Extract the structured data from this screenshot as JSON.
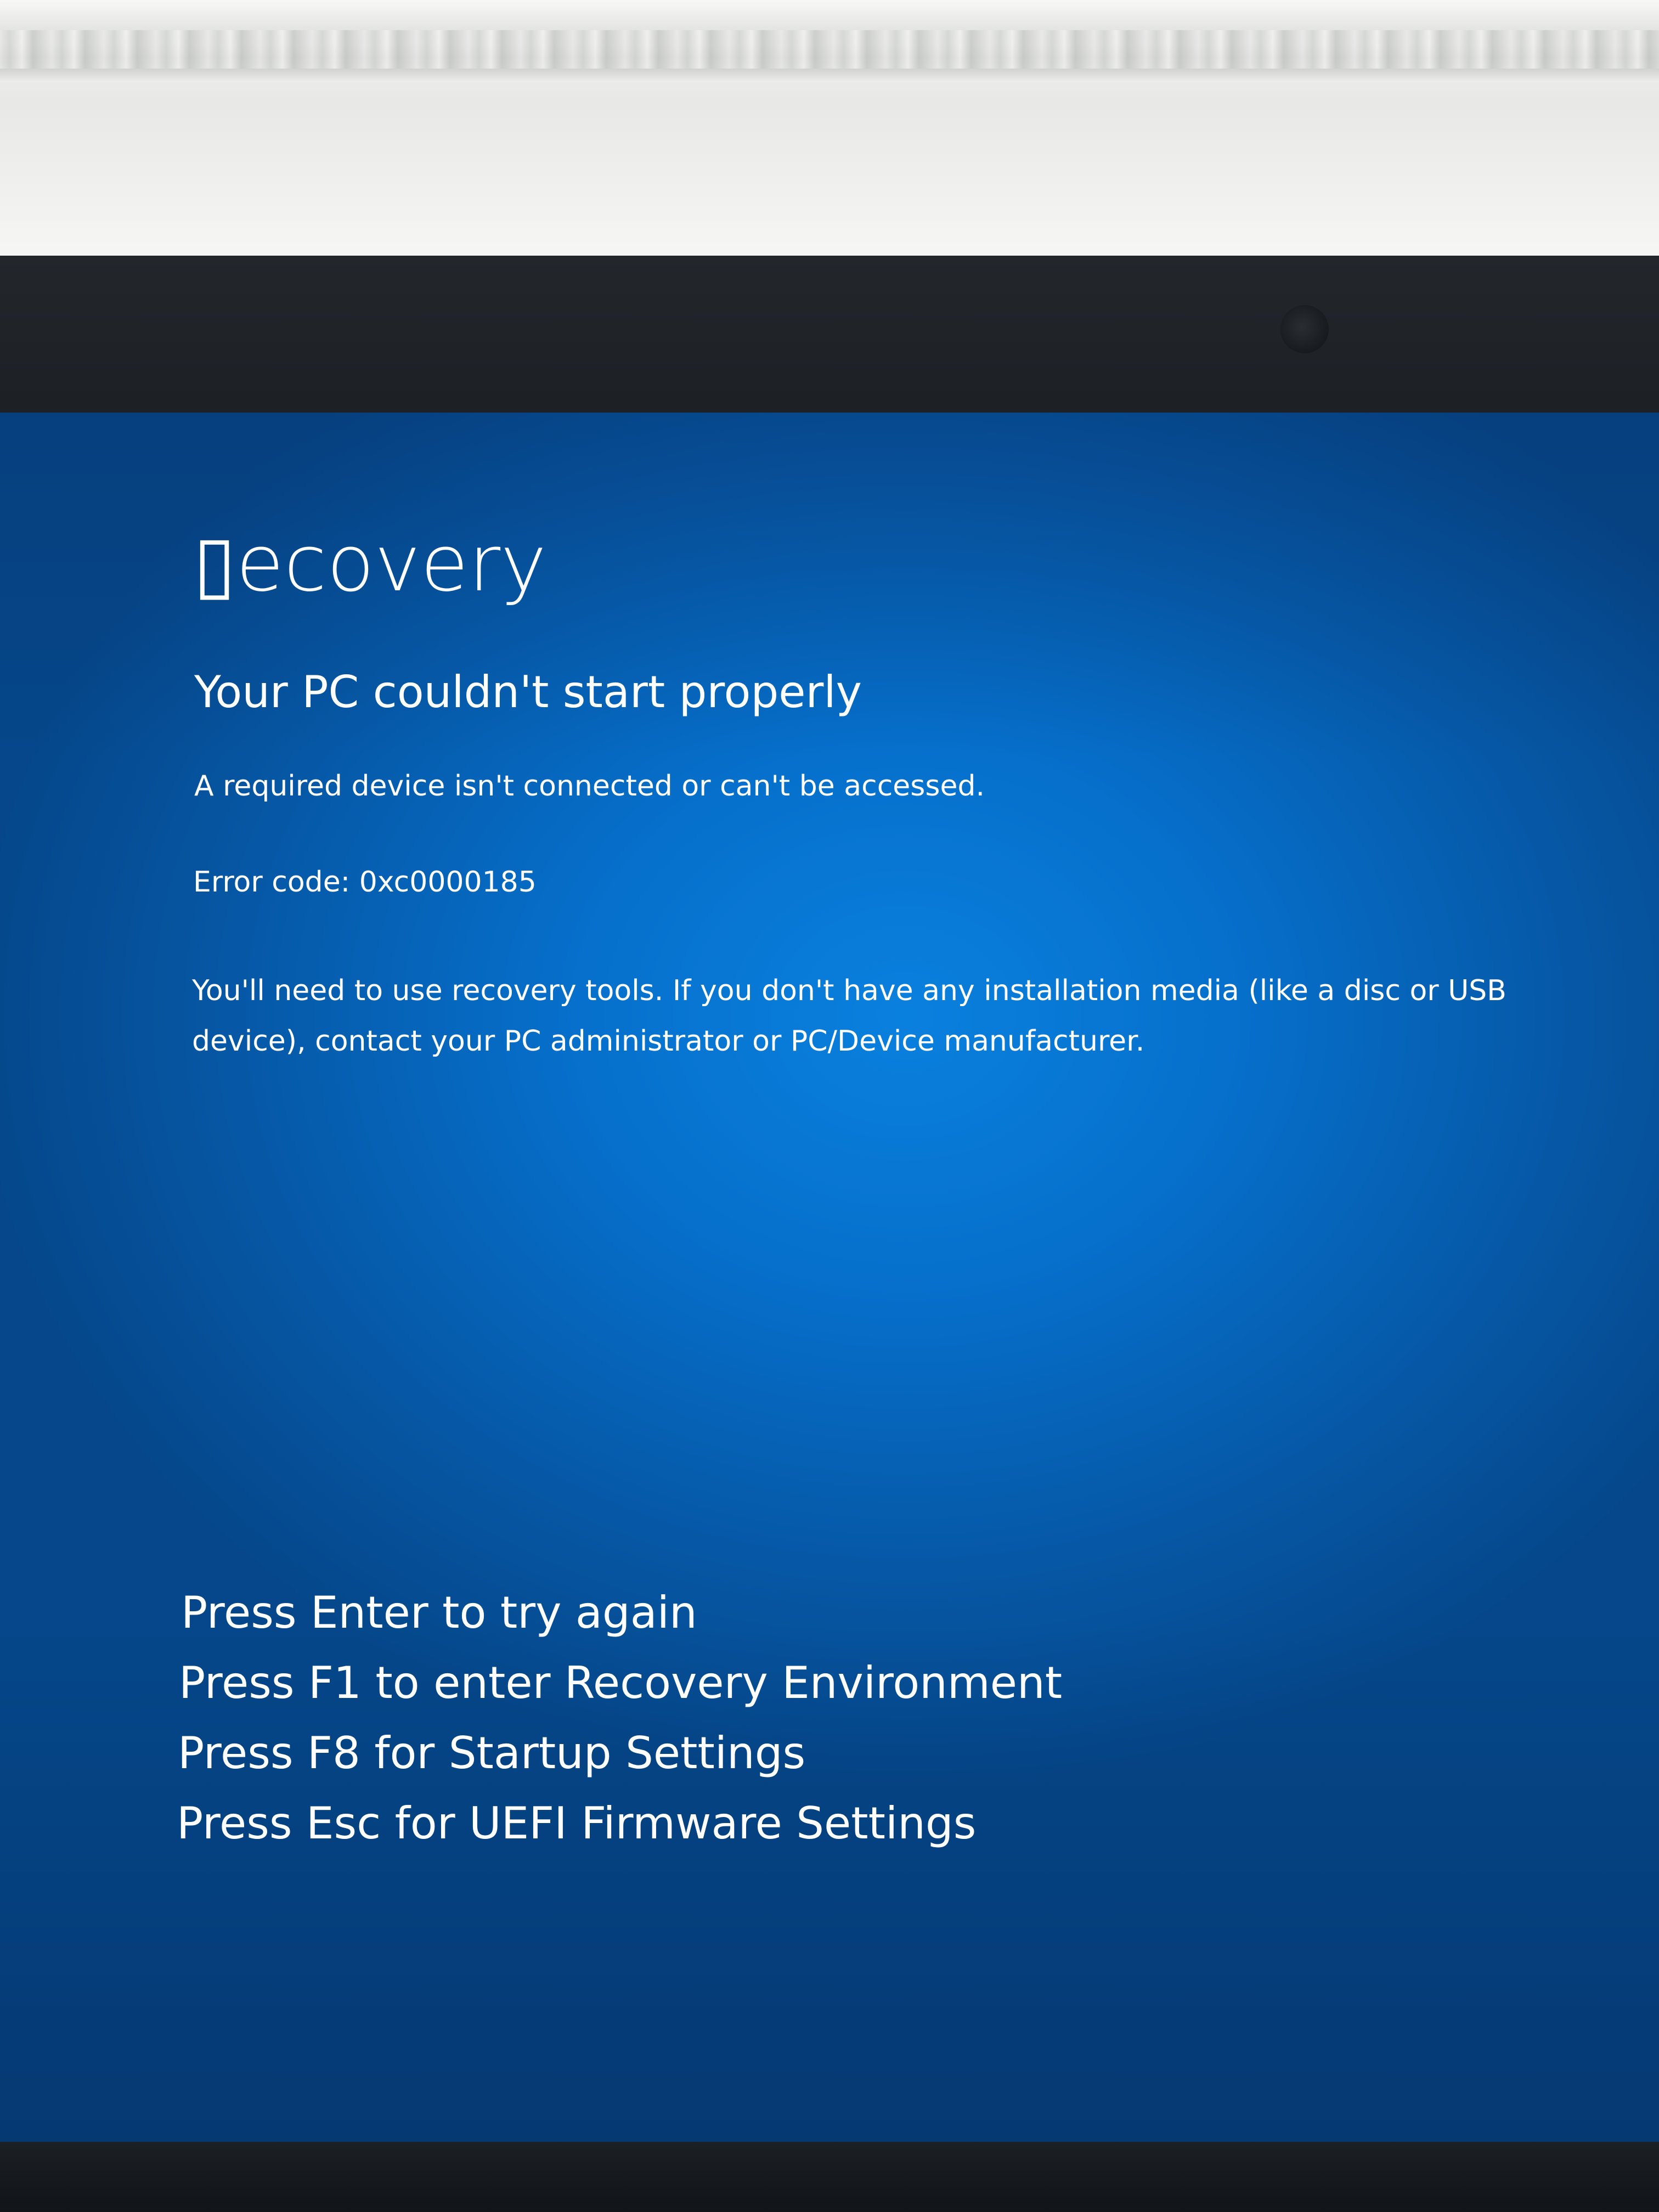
{
  "recovery": {
    "title": "▯ecovery",
    "subtitle": "Your PC couldn't start properly",
    "detail": "A required device isn't connected or can't be accessed.",
    "error_code": "Error code: 0xc0000185",
    "instruction": "You'll need to use recovery tools. If you don't have any installation media (like a disc or USB device), contact your PC administrator or PC/Device manufacturer."
  },
  "options": [
    {
      "label": "Press Enter to try again"
    },
    {
      "label": "Press F1 to enter Recovery Environment"
    },
    {
      "label": "Press F8 for Startup Settings"
    },
    {
      "label": "Press Esc for UEFI Firmware Settings"
    }
  ],
  "colors": {
    "screen_background": "#0670cc",
    "text": "#ffffff",
    "bezel": "#1b1f24"
  }
}
